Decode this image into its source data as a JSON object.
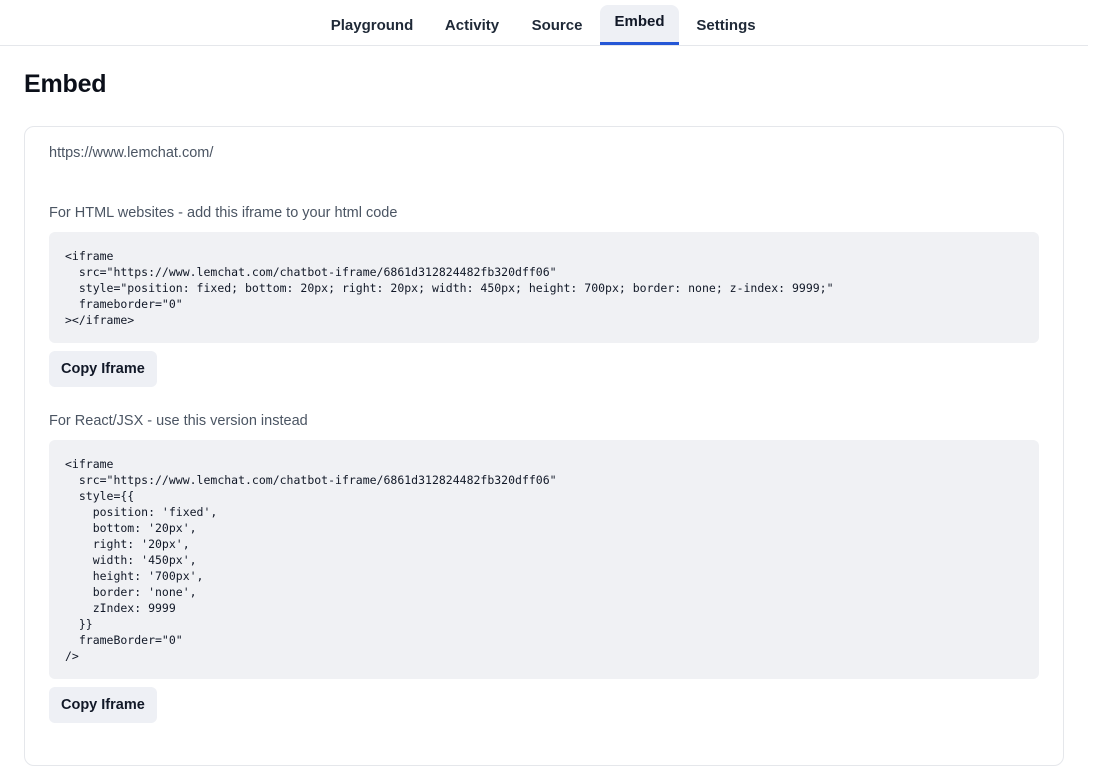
{
  "nav": {
    "tabs": [
      {
        "label": "Playground"
      },
      {
        "label": "Activity"
      },
      {
        "label": "Source"
      },
      {
        "label": "Embed"
      },
      {
        "label": "Settings"
      }
    ],
    "active_tab": "Embed",
    "accent_color": "#2557d6"
  },
  "page": {
    "title": "Embed"
  },
  "embed": {
    "url": "https://www.lemchat.com/",
    "html_section": {
      "label": "For HTML websites - add this iframe to your html code",
      "code_lines": [
        "<iframe",
        "  src=\"https://www.lemchat.com/chatbot-iframe/6861d312824482fb320dff06\"",
        "  style=\"position: fixed; bottom: 20px; right: 20px; width: 450px; height: 700px; border: none; z-index: 9999;\"",
        "  frameborder=\"0\"",
        "></iframe>"
      ],
      "copy_label": "Copy Iframe"
    },
    "react_section": {
      "label": "For React/JSX - use this version instead",
      "code_lines": [
        "<iframe",
        "  src=\"https://www.lemchat.com/chatbot-iframe/6861d312824482fb320dff06\"",
        "  style={{",
        "    position: 'fixed',",
        "    bottom: '20px',",
        "    right: '20px',",
        "    width: '450px',",
        "    height: '700px',",
        "    border: 'none',",
        "    zIndex: 9999",
        "  }}",
        "  frameBorder=\"0\"",
        "/>"
      ],
      "copy_label": "Copy Iframe"
    }
  }
}
